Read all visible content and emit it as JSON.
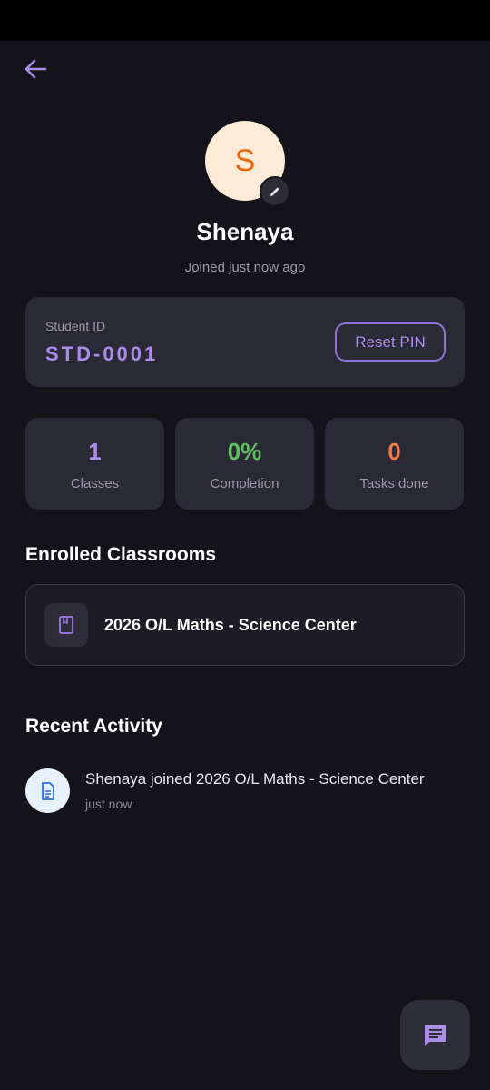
{
  "profile": {
    "initial": "S",
    "name": "Shenaya",
    "joined": "Joined just now ago"
  },
  "student_card": {
    "label": "Student ID",
    "id": "STD-0001",
    "reset_button": "Reset PIN"
  },
  "stats": [
    {
      "value": "1",
      "label": "Classes",
      "color": "#a98de6"
    },
    {
      "value": "0%",
      "label": "Completion",
      "color": "#5fbf5f"
    },
    {
      "value": "0",
      "label": "Tasks done",
      "color": "#f07a48"
    }
  ],
  "enrolled": {
    "title": "Enrolled Classrooms",
    "items": [
      {
        "name": "2026 O/L Maths - Science Center",
        "icon": "book-icon"
      }
    ]
  },
  "activity": {
    "title": "Recent Activity",
    "items": [
      {
        "text": "Shenaya joined 2026 O/L Maths - Science Center",
        "time": "just now",
        "icon": "document-icon"
      }
    ]
  },
  "icons": {
    "back": "arrow-left-icon",
    "edit": "pencil-icon",
    "fab": "chat-icon"
  },
  "colors": {
    "accent": "#a98de6",
    "background": "#141319",
    "card": "#2a2936"
  }
}
